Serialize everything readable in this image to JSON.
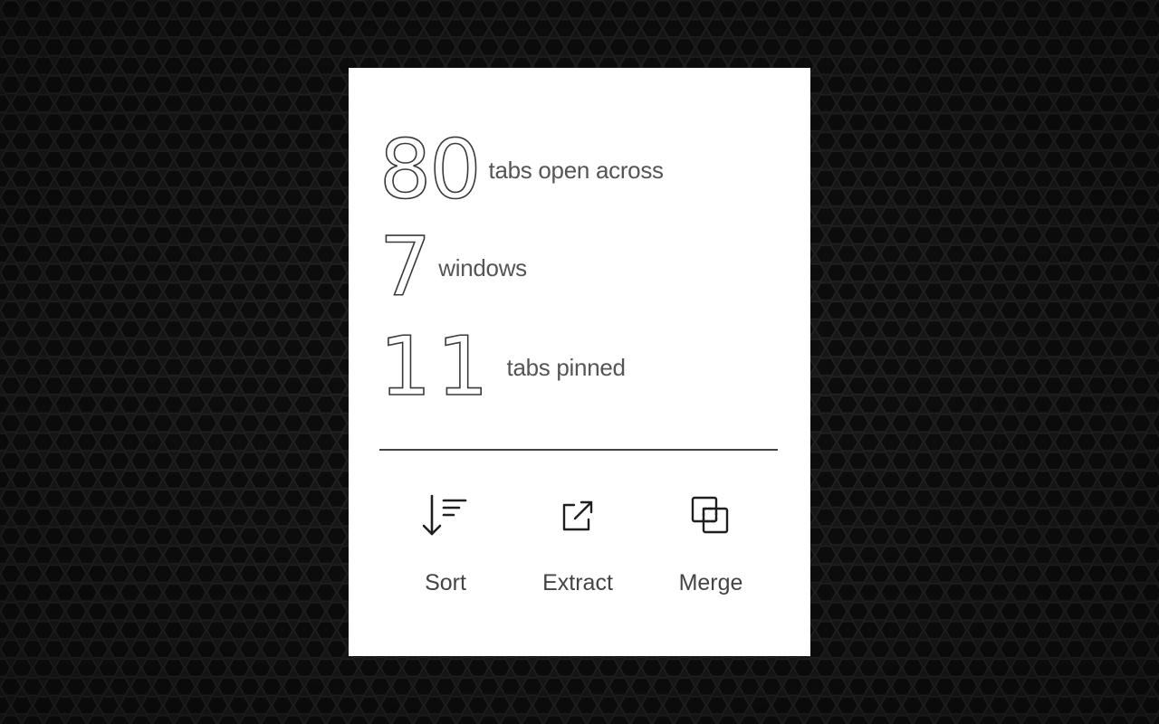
{
  "stats": {
    "tabs_open": {
      "value": "80",
      "label": "tabs open across"
    },
    "windows": {
      "value": "7",
      "label": "windows"
    },
    "tabs_pinned": {
      "value": "11",
      "label": "tabs pinned"
    }
  },
  "actions": [
    {
      "label": "Sort",
      "icon": "sort-descending-icon"
    },
    {
      "label": "Extract",
      "icon": "external-link-icon"
    },
    {
      "label": "Merge",
      "icon": "merge-windows-icon"
    }
  ],
  "colors": {
    "background": "#171717",
    "card": "#ffffff",
    "text": "#444444"
  }
}
